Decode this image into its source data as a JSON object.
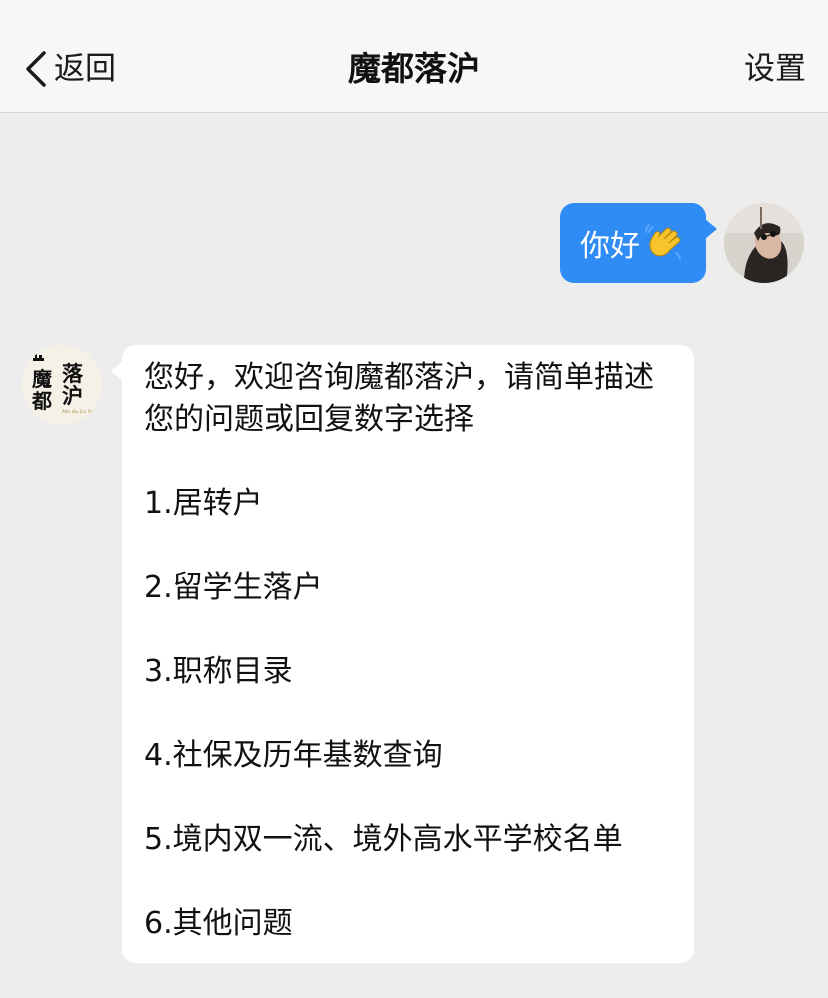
{
  "navbar": {
    "back_label": "返回",
    "title": "魔都落沪",
    "settings_label": "设置"
  },
  "messages": {
    "outgoing": {
      "text": "你好",
      "emoji": "waving-hand-icon"
    },
    "incoming": {
      "intro": "您好，欢迎咨询魔都落沪，请简单描述您的问题或回复数字选择",
      "options": [
        "1.居转户",
        "2.留学生落户",
        "3.职称目录",
        "4.社保及历年基数查询",
        "5.境内双一流、境外高水平学校名单",
        "6.其他问题"
      ]
    }
  },
  "avatar_logo": {
    "text_main": "魔都",
    "text_side": "落沪",
    "text_small": "Mo du Lu hu"
  },
  "colors": {
    "outgoing_bubble": "#2f8cf5",
    "incoming_bubble": "#ffffff",
    "background": "#ededed",
    "navbar": "#f7f7f7"
  }
}
